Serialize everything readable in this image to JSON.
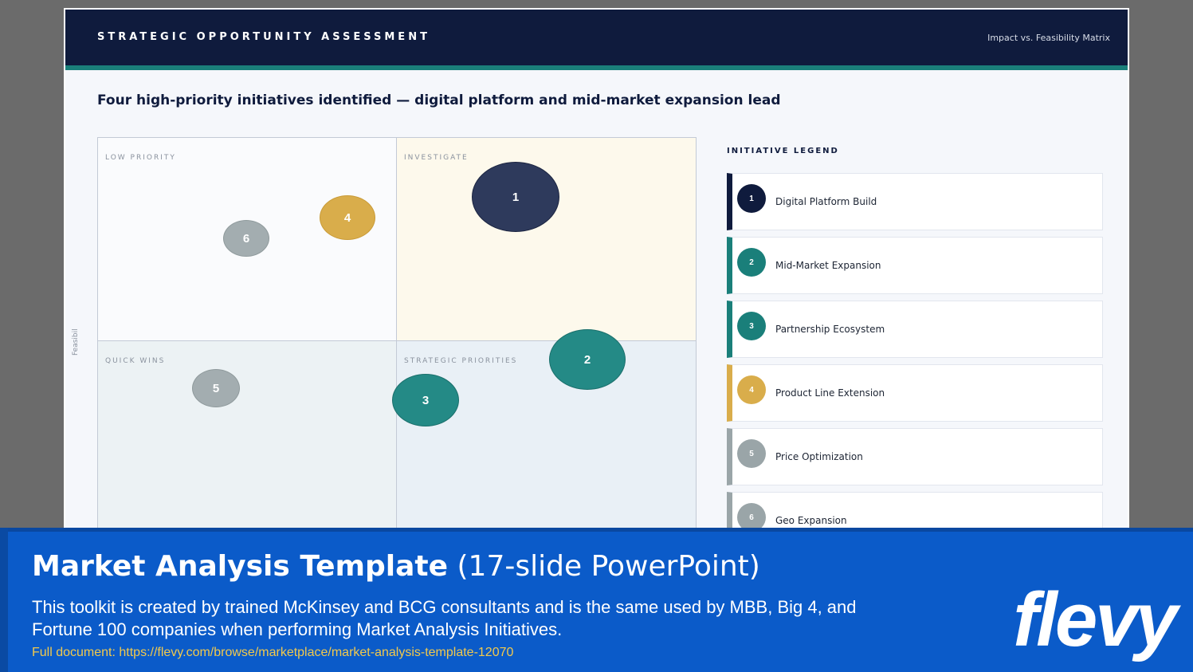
{
  "slide": {
    "header_title": "STRATEGIC OPPORTUNITY ASSESSMENT",
    "header_subtitle": "Impact vs. Feasibility Matrix",
    "headline": "Four high-priority initiatives identified — digital platform and mid-market expansion lead",
    "y_axis_label": "Feasibility"
  },
  "quadrants": {
    "low_priority": "LOW PRIORITY",
    "investigate": "INVESTIGATE",
    "quick_wins": "QUICK WINS",
    "strategic_priorities": "STRATEGIC PRIORITIES"
  },
  "bubbles": [
    {
      "id": "1",
      "color": "#2e3a5c"
    },
    {
      "id": "2",
      "color": "#248a86"
    },
    {
      "id": "3",
      "color": "#248a86"
    },
    {
      "id": "4",
      "color": "#d9ad4b"
    },
    {
      "id": "5",
      "color": "#a3adb0"
    },
    {
      "id": "6",
      "color": "#a3adb0"
    }
  ],
  "legend": {
    "title": "INITIATIVE LEGEND",
    "items": [
      {
        "num": "1",
        "label": "Digital Platform Build",
        "color": "#0f1b3d"
      },
      {
        "num": "2",
        "label": "Mid-Market Expansion",
        "color": "#1a7f7a"
      },
      {
        "num": "3",
        "label": "Partnership Ecosystem",
        "color": "#1a7f7a"
      },
      {
        "num": "4",
        "label": "Product Line Extension",
        "color": "#d9ad4b"
      },
      {
        "num": "5",
        "label": "Price Optimization",
        "color": "#9aa5a8"
      },
      {
        "num": "6",
        "label": "Geo Expansion",
        "color": "#9aa5a8"
      }
    ]
  },
  "banner": {
    "title_bold": "Market Analysis Template",
    "title_light": "(17-slide PowerPoint)",
    "description": "This toolkit is created by trained McKinsey and BCG consultants and is the same used by MBB, Big 4, and Fortune 100 companies when performing Market Analysis Initiatives.",
    "link": "Full document: https://flevy.com/browse/marketplace/market-analysis-template-12070",
    "brand": "flevy"
  }
}
